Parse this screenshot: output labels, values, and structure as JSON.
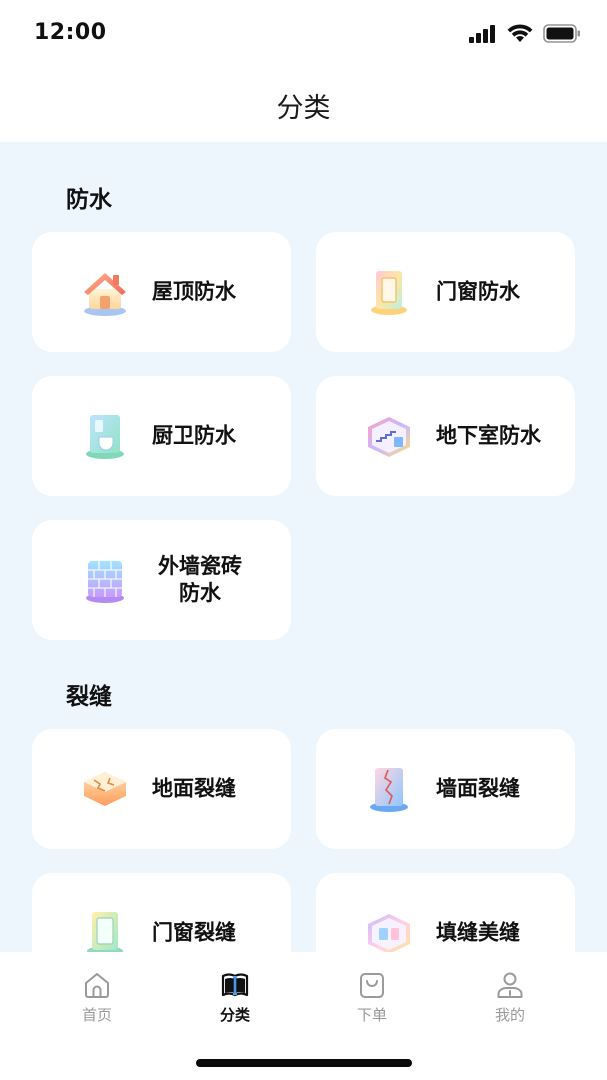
{
  "status": {
    "time": "12:00"
  },
  "header": {
    "title": "分类"
  },
  "sections": [
    {
      "title": "防水",
      "items": [
        {
          "label": "屋顶防水",
          "icon": "house-roof-icon"
        },
        {
          "label": "门窗防水",
          "icon": "door-window-icon"
        },
        {
          "label": "厨卫防水",
          "icon": "bathroom-icon"
        },
        {
          "label": "地下室防水",
          "icon": "basement-icon"
        },
        {
          "label_line1": "外墙瓷砖",
          "label_line2": "防水",
          "icon": "tile-wall-icon"
        }
      ]
    },
    {
      "title": "裂缝",
      "items": [
        {
          "label": "地面裂缝",
          "icon": "floor-crack-icon"
        },
        {
          "label": "墙面裂缝",
          "icon": "wall-crack-icon"
        },
        {
          "label": "门窗裂缝",
          "icon": "door-window-crack-icon"
        },
        {
          "label": "填缝美缝",
          "icon": "grout-seam-icon"
        }
      ]
    }
  ],
  "tabs": [
    {
      "label": "首页",
      "icon": "home-icon",
      "active": false
    },
    {
      "label": "分类",
      "icon": "book-icon",
      "active": true
    },
    {
      "label": "下单",
      "icon": "shopping-bag-icon",
      "active": false
    },
    {
      "label": "我的",
      "icon": "user-icon",
      "active": false
    }
  ],
  "colors": {
    "background": "#eef6fd",
    "card": "#ffffff",
    "active_tab": "#111111",
    "inactive_tab": "#9a9a9a"
  }
}
